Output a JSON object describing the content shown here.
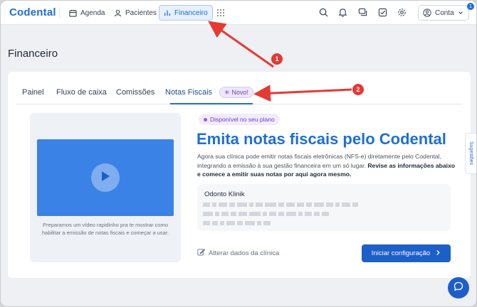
{
  "app": {
    "logo": "Codental"
  },
  "nav": {
    "items": [
      {
        "label": "Agenda",
        "icon": "calendar-icon"
      },
      {
        "label": "Pacientes",
        "icon": "user-icon"
      },
      {
        "label": "Financeiro",
        "icon": "bar-chart-icon",
        "active": true
      }
    ],
    "right_icons": [
      "search-icon",
      "bell-icon",
      "chat-icon",
      "check-square-icon",
      "gear-icon"
    ],
    "account": {
      "label": "Conta",
      "badge": "1"
    }
  },
  "page": {
    "title": "Financeiro"
  },
  "tabs": [
    {
      "label": "Painel"
    },
    {
      "label": "Fluxo de caixa"
    },
    {
      "label": "Comissões"
    },
    {
      "label": "Notas Fiscais",
      "active": true
    }
  ],
  "novo_badge": "Novo!",
  "video": {
    "caption": "Preparamos um vídeo rapidinho pra te mostrar como habilitar a emissão de notas fiscais e começar a usar."
  },
  "plan_badge": "Disponível no seu plano",
  "headline": "Emita notas fiscais pelo Codental",
  "description": {
    "text": "Agora sua clínica pode emitir notas fiscais eletrônicas (NFS-e) diretamente pelo Codental, integrando a emissão à sua gestão financeira em um só lugar. ",
    "bold": "Revise as informações abaixo e comece a emitir suas notas por aqui agora mesmo."
  },
  "clinic": {
    "name": "Odonto Klinik"
  },
  "edit_link": "Alterar dados da clínica",
  "cta": "Iniciar configuração",
  "sugestoes": "Sugestões",
  "annotations": [
    "1",
    "2"
  ],
  "colors": {
    "brand": "#1d6fd6",
    "cta": "#1d5fc9",
    "annotation": "#e53935",
    "novo": "#6d3fc4"
  }
}
